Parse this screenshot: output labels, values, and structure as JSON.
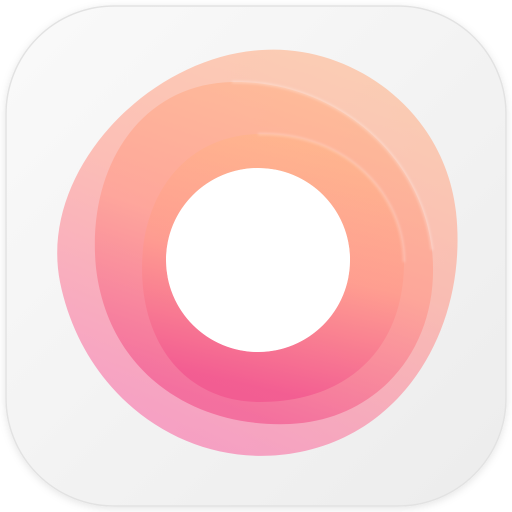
{
  "icon": {
    "name": "ring-logo",
    "colors": {
      "tile_light": "#fafafa",
      "tile_dark": "#ececec",
      "tile_edge": "#e2e2e2",
      "peach": "#ffb48c",
      "salmon": "#ff9c8e",
      "pink": "#f86fa6",
      "hot_pink": "#f2578f"
    }
  }
}
